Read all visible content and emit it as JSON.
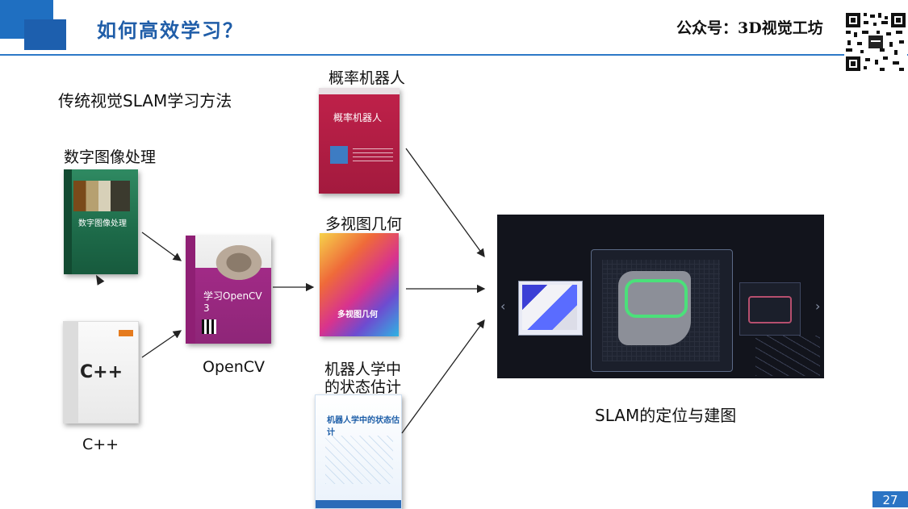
{
  "header": {
    "title": "如何高效学习？",
    "right_label": "公众号：3D视觉工坊"
  },
  "main": {
    "section_title": "传统视觉SLAM学习方法",
    "inputs": {
      "dip_label": "数字图像处理",
      "cpp_label": "C++",
      "opencv_label": "OpenCV"
    },
    "books": {
      "prob_label": "概率机器人",
      "mvg_label": "多视图几何",
      "se_label_line1": "机器人学中",
      "se_label_line2": "的状态估计"
    },
    "covers": {
      "dip_title": "数字图像处理",
      "cpp_title": "C++",
      "ocv_title": "学习OpenCV 3",
      "prob_title": "概率机器人",
      "mvg_title": "多视图几何",
      "se_title": "机器人学中的状态估计"
    },
    "result_label": "SLAM的定位与建图"
  },
  "footer": {
    "page_number": "27"
  },
  "colors": {
    "accent": "#1f6fc1",
    "title_text": "#1f5da8"
  }
}
